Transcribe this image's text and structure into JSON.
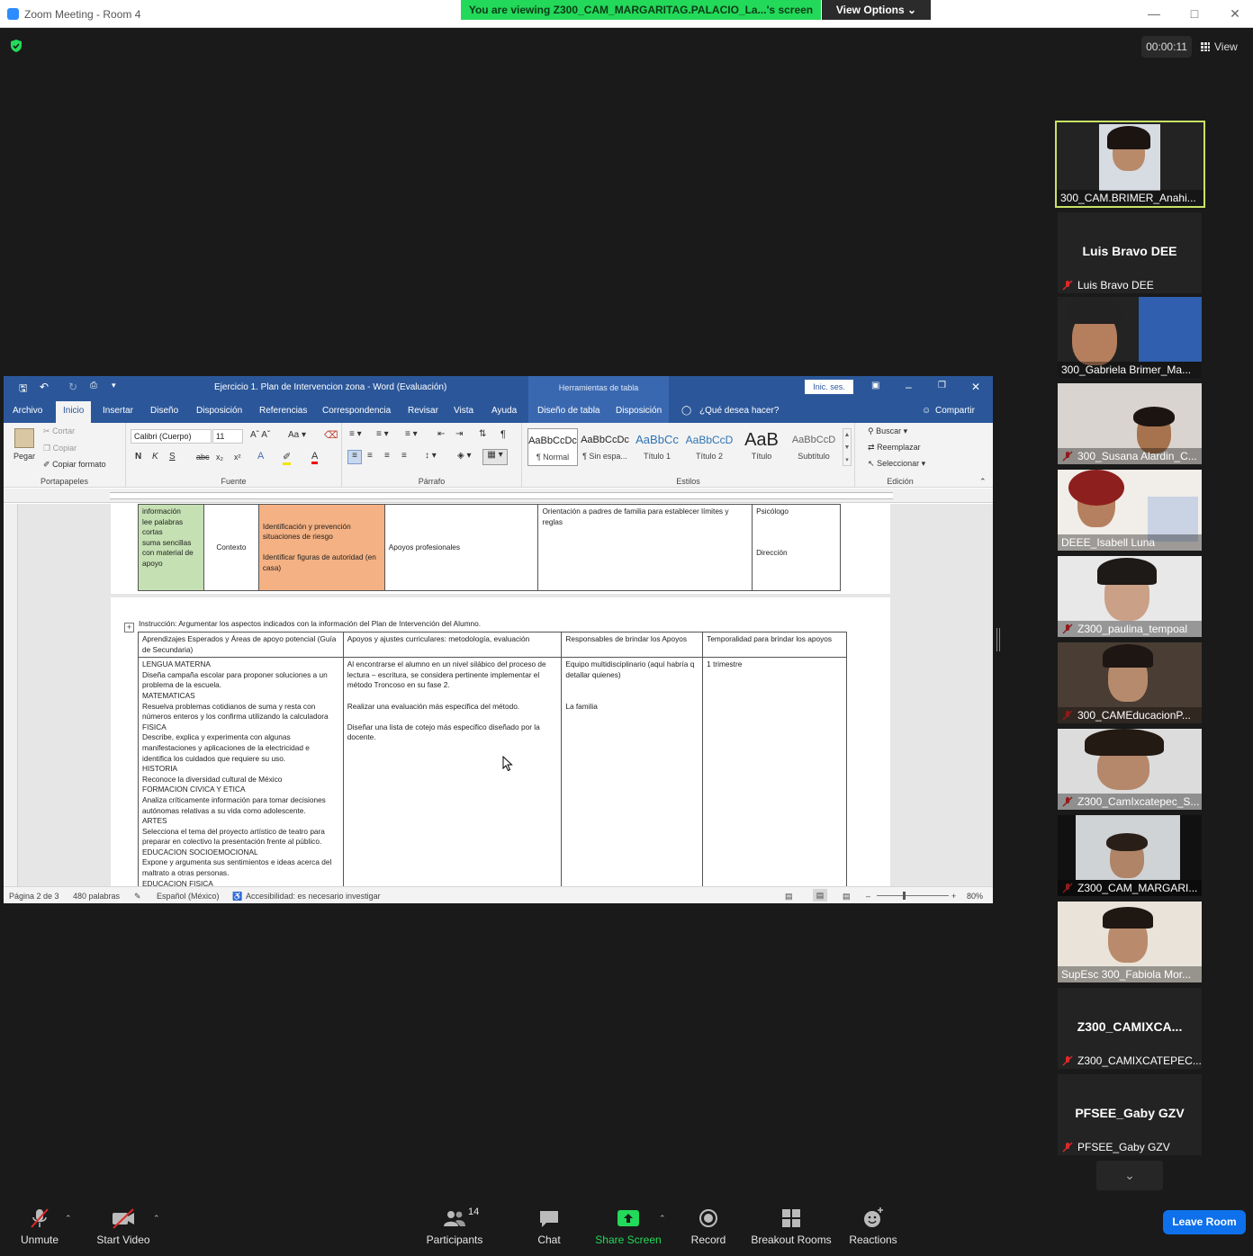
{
  "window": {
    "title": "Zoom Meeting - Room 4"
  },
  "share_banner": {
    "text": "You are viewing Z300_CAM_MARGARITAG.PALACIO_La...'s screen",
    "view_options": "View Options"
  },
  "top_right": {
    "timer": "00:00:11",
    "view": "View"
  },
  "word": {
    "doc_title": "Ejercicio 1. Plan de Intervencion zona  -  Word (Evaluación)",
    "tools_title": "Herramientas de tabla",
    "signin": "Inic. ses.",
    "tabs": [
      "Archivo",
      "Inicio",
      "Insertar",
      "Diseño",
      "Disposición",
      "Referencias",
      "Correspondencia",
      "Revisar",
      "Vista",
      "Ayuda",
      "Diseño de tabla",
      "Disposición"
    ],
    "tell_me": "¿Qué desea hacer?",
    "share": "Compartir",
    "ribbon": {
      "clipboard": {
        "paste": "Pegar",
        "cut": "Cortar",
        "copy": "Copiar",
        "format_painter": "Copiar formato",
        "label": "Portapapeles"
      },
      "font": {
        "name": "Calibri (Cuerpo)",
        "size": "11",
        "label": "Fuente"
      },
      "paragraph": {
        "label": "Párrafo"
      },
      "styles": {
        "label": "Estilos",
        "items": [
          {
            "sample": "AaBbCcDc",
            "name": "¶ Normal"
          },
          {
            "sample": "AaBbCcDc",
            "name": "¶ Sin espa..."
          },
          {
            "sample": "AaBbCc",
            "name": "Título 1"
          },
          {
            "sample": "AaBbCcD",
            "name": "Título 2"
          },
          {
            "sample": "AaB",
            "name": "Título"
          },
          {
            "sample": "AaBbCcD",
            "name": "Subtítulo"
          }
        ]
      },
      "editing": {
        "find": "Buscar",
        "replace": "Reemplazar",
        "select": "Seleccionar",
        "label": "Edición"
      }
    },
    "table1": {
      "col1": "información\nlee palabras\ncortas\nsuma sencillas\ncon material de\napoyo",
      "col2": "Contexto",
      "col3": "Identificación y prevención situaciones de riesgo\n\nIdentificar figuras de autoridad (en casa)",
      "col4": "Apoyos profesionales",
      "col5": "Orientación a padres de familia para establecer límites y reglas",
      "col6a": "Psicólogo",
      "col6b": "Dirección"
    },
    "instruction": "Instrucción: Argumentar los aspectos indicados con la información del Plan de Intervención del Alumno.",
    "table2": {
      "headers": [
        "Aprendizajes Esperados y Áreas de apoyo potencial (Guía de Secundaria)",
        "Apoyos y ajustes curriculares: metodología, evaluación",
        "Responsables de brindar los Apoyos",
        "Temporalidad para brindar los apoyos"
      ],
      "col1": "LENGUA MATERNA\nDiseña campaña escolar para proponer soluciones a un problema de la escuela.\nMATEMATICAS\nResuelva problemas cotidianos de suma y resta con números enteros y los confirma utilizando la calculadora\nFISICA\nDescribe, explica y experimenta con algunas manifestaciones y aplicaciones de la electricidad e identifica los cuidados que requiere su uso.\nHISTORIA\nReconoce la diversidad cultural de México\nFORMACION CIVICA Y ETICA\nAnaliza críticamente información para tomar decisiones autónomas relativas a su vida como adolescente.\nARTES\nSelecciona el tema del proyecto artístico de teatro para preparar en colectivo la presentación frente al público.\nEDUCACION SOCIOEMOCIONAL\nExpone y argumenta sus sentimientos e ideas acerca del maltrato a otras personas.\nEDUCACION FISICA",
      "col2": "Al encontrarse el alumno en un nivel silábico del proceso de lectura – escritura, se considera pertinente implementar el método Troncoso en su fase 2.\n\nRealizar una evaluación más especifica del método.\n\nDiseñar una lista de cotejo más especifico diseñado por la docente.",
      "col3": "Equipo multidisciplinario (aquí habría q detallar quienes)\n\n\nLa familia",
      "col4": "1 trimestre"
    },
    "status": {
      "page": "Página 2 de 3",
      "words": "480 palabras",
      "language": "Español (México)",
      "accessibility": "Accesibilidad: es necesario investigar",
      "zoom": "80%"
    }
  },
  "participants": [
    {
      "name": "300_CAM.BRIMER_Anahi...",
      "muted": false,
      "video": true
    },
    {
      "name": "Luis Bravo DEE",
      "display": "Luis Bravo DEE",
      "muted": true,
      "video": false
    },
    {
      "name": "300_Gabriela Brimer_Ma...",
      "muted": false,
      "video": true
    },
    {
      "name": "300_Susana Alardin_C...",
      "muted": true,
      "video": true
    },
    {
      "name": "DEEE_Isabell Luna",
      "muted": false,
      "video": true
    },
    {
      "name": "Z300_paulina_tempoal",
      "muted": true,
      "video": true
    },
    {
      "name": "300_CAMEducacionP...",
      "muted": true,
      "video": true
    },
    {
      "name": "Z300_CamIxcatepec_S...",
      "muted": true,
      "video": true
    },
    {
      "name": "Z300_CAM_MARGARI...",
      "muted": true,
      "video": true
    },
    {
      "name": "SupEsc 300_Fabiola Mor...",
      "muted": false,
      "video": true
    },
    {
      "name": "Z300_CAMIXCATEPEC...",
      "display": "Z300_CAMIXCA...",
      "muted": true,
      "video": false
    },
    {
      "name": "PFSEE_Gaby GZV",
      "display": "PFSEE_Gaby GZV",
      "muted": true,
      "video": false
    }
  ],
  "toolbar": {
    "unmute": "Unmute",
    "start_video": "Start Video",
    "participants": "Participants",
    "participants_count": "14",
    "chat": "Chat",
    "share_screen": "Share Screen",
    "record": "Record",
    "breakout": "Breakout Rooms",
    "reactions": "Reactions",
    "leave": "Leave Room"
  },
  "colors": {
    "accent": "#2d8cff",
    "share_green": "#23d959",
    "word_blue": "#2b579a",
    "leave_blue": "#0e71eb",
    "active_speaker": "#c9e265",
    "muted_red": "#e02828"
  }
}
